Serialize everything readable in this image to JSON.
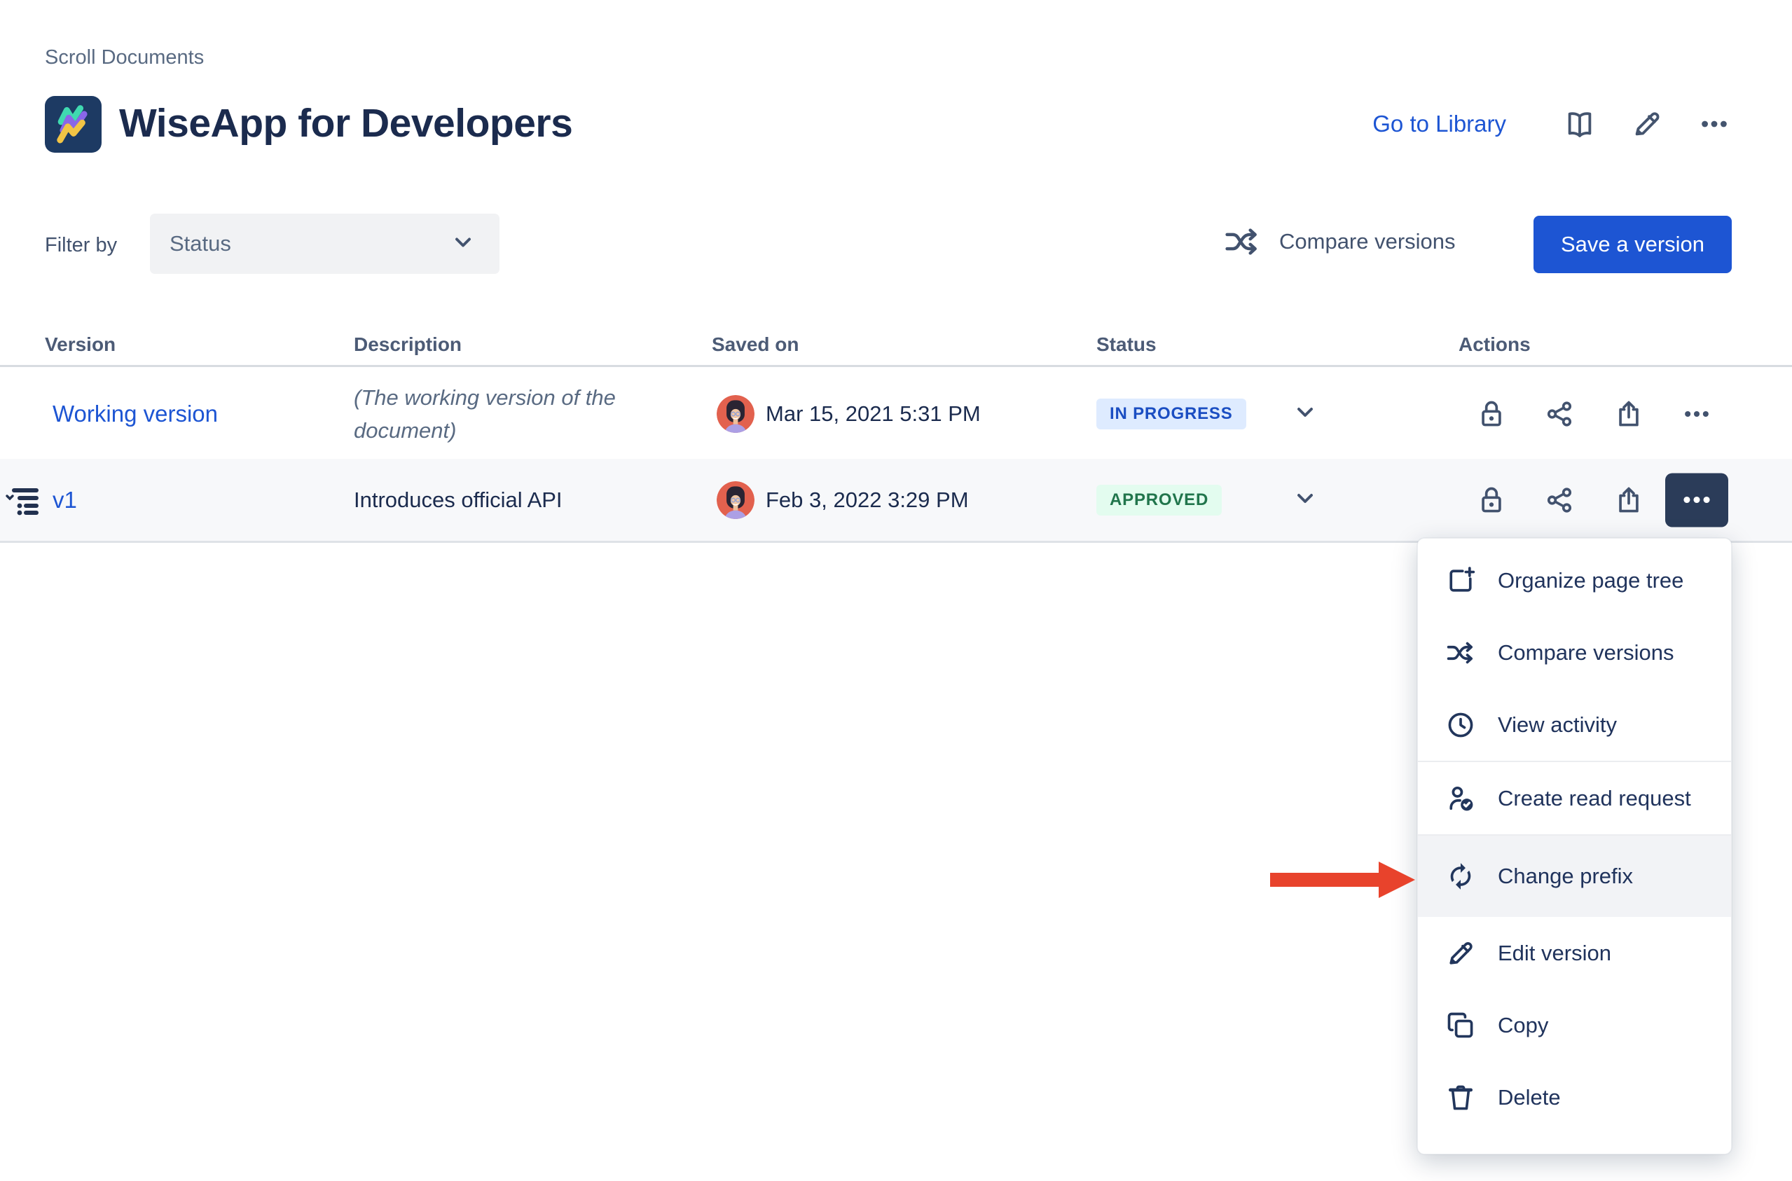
{
  "breadcrumb": "Scroll Documents",
  "header": {
    "title": "WiseApp for Developers",
    "library_link": "Go to Library"
  },
  "toolbar": {
    "filter_label": "Filter by",
    "status_placeholder": "Status",
    "compare_label": "Compare versions",
    "save_label": "Save a version"
  },
  "table": {
    "headers": [
      "Version",
      "Description",
      "Saved on",
      "Status",
      "Actions"
    ],
    "rows": [
      {
        "version": "Working version",
        "description": "(The working version of the document)",
        "saved_on": "Mar 15, 2021 5:31 PM",
        "status": "IN PROGRESS"
      },
      {
        "version": "v1",
        "description": "Introduces official API",
        "saved_on": "Feb 3, 2022 3:29 PM",
        "status": "APPROVED"
      }
    ]
  },
  "menu": {
    "items": [
      "Organize page tree",
      "Compare versions",
      "View activity",
      "Create read request",
      "Change prefix",
      "Edit version",
      "Copy",
      "Delete"
    ],
    "highlighted_item": "Change prefix"
  },
  "colors": {
    "accent_blue": "#1D55D3",
    "navy_text": "#1B2B4E",
    "badge_in_progress_bg": "#DEEBFF",
    "badge_in_progress_text": "#1B4EC2",
    "badge_approved_bg": "#E3FCEF",
    "badge_approved_text": "#21754C",
    "active_button_bg": "#2B3C59",
    "arrow_red": "#E8432C",
    "logo_bg": "#1D3A63"
  }
}
